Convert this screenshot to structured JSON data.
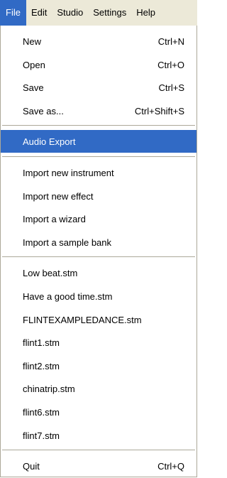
{
  "colors": {
    "highlight": "#316ac5",
    "menubar_bg": "#ece9d8",
    "separator": "#aca899"
  },
  "menubar": {
    "items": [
      "File",
      "Edit",
      "Studio",
      "Settings",
      "Help"
    ],
    "active": "File"
  },
  "file_menu": {
    "groups": [
      [
        {
          "label": "New",
          "shortcut": "Ctrl+N"
        },
        {
          "label": "Open",
          "shortcut": "Ctrl+O"
        },
        {
          "label": "Save",
          "shortcut": "Ctrl+S"
        },
        {
          "label": "Save as...",
          "shortcut": "Ctrl+Shift+S"
        }
      ],
      [
        {
          "label": "Audio Export",
          "shortcut": "",
          "highlighted": true
        }
      ],
      [
        {
          "label": "Import new instrument",
          "shortcut": ""
        },
        {
          "label": "Import new effect",
          "shortcut": ""
        },
        {
          "label": "Import a wizard",
          "shortcut": ""
        },
        {
          "label": "Import a sample bank",
          "shortcut": ""
        }
      ],
      [
        {
          "label": "Low beat.stm",
          "shortcut": ""
        },
        {
          "label": "Have a good time.stm",
          "shortcut": ""
        },
        {
          "label": "FLINTEXAMPLEDANCE.stm",
          "shortcut": ""
        },
        {
          "label": "flint1.stm",
          "shortcut": ""
        },
        {
          "label": "flint2.stm",
          "shortcut": ""
        },
        {
          "label": "chinatrip.stm",
          "shortcut": ""
        },
        {
          "label": "flint6.stm",
          "shortcut": ""
        },
        {
          "label": "flint7.stm",
          "shortcut": ""
        }
      ],
      [
        {
          "label": "Quit",
          "shortcut": "Ctrl+Q"
        }
      ]
    ]
  }
}
